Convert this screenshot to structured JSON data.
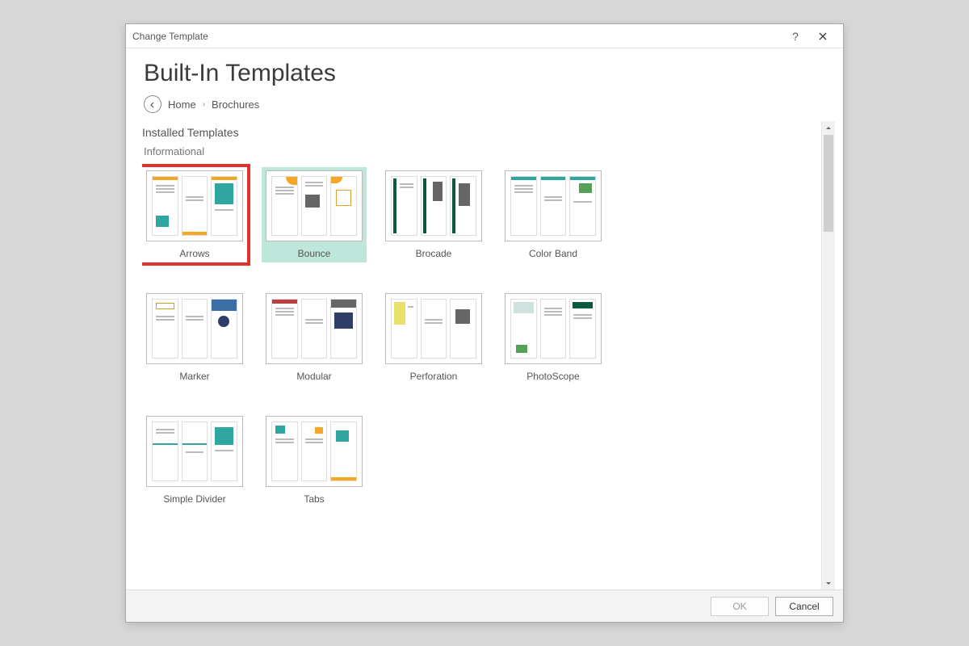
{
  "dialog": {
    "title": "Change Template",
    "heading": "Built-In Templates",
    "help_char": "?"
  },
  "breadcrumb": {
    "home": "Home",
    "separator": "›",
    "current": "Brochures"
  },
  "sections": {
    "installed": "Installed Templates",
    "informational": "Informational"
  },
  "templates": {
    "rows": [
      [
        {
          "label": "Arrows",
          "highlighted": true,
          "selected": false
        },
        {
          "label": "Bounce",
          "highlighted": false,
          "selected": true
        },
        {
          "label": "Brocade",
          "highlighted": false,
          "selected": false
        },
        {
          "label": "Color Band",
          "highlighted": false,
          "selected": false
        }
      ],
      [
        {
          "label": "Marker",
          "highlighted": false,
          "selected": false
        },
        {
          "label": "Modular",
          "highlighted": false,
          "selected": false
        },
        {
          "label": "Perforation",
          "highlighted": false,
          "selected": false
        },
        {
          "label": "PhotoScope",
          "highlighted": false,
          "selected": false
        }
      ],
      [
        {
          "label": "Simple Divider",
          "highlighted": false,
          "selected": false
        },
        {
          "label": "Tabs",
          "highlighted": false,
          "selected": false
        }
      ]
    ]
  },
  "buttons": {
    "ok": "OK",
    "cancel": "Cancel",
    "ok_enabled": false
  }
}
